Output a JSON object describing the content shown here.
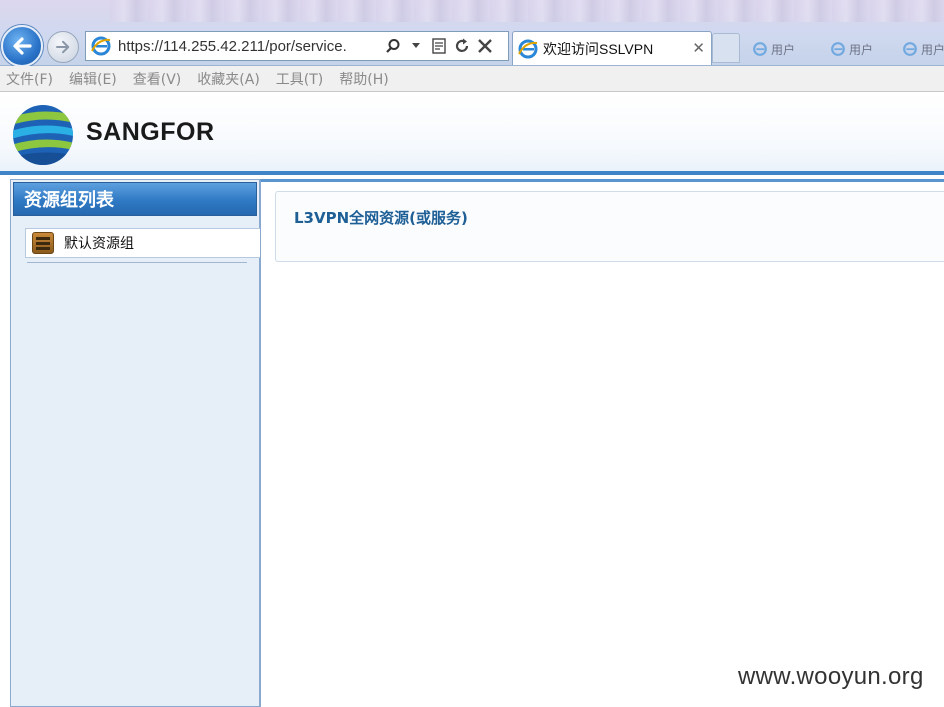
{
  "browser": {
    "url": "https://114.255.42.211/por/service.",
    "tab_title": "欢迎访问SSLVPN",
    "favorites": [
      "用户",
      "用户",
      "用户"
    ]
  },
  "menu": {
    "items": [
      "文件(F)",
      "编辑(E)",
      "查看(V)",
      "收藏夹(A)",
      "工具(T)",
      "帮助(H)"
    ]
  },
  "header": {
    "brand": "SANGFOR"
  },
  "sidebar": {
    "title": "资源组列表",
    "groups": [
      {
        "label": "默认资源组"
      }
    ]
  },
  "main": {
    "resource_title": "L3VPN全网资源(或服务)"
  },
  "watermark": "www.wooyun.org",
  "colors": {
    "accent": "#3f84c7",
    "sidebar_bg": "#e6eef8",
    "title_blue": "#1e5f96"
  }
}
